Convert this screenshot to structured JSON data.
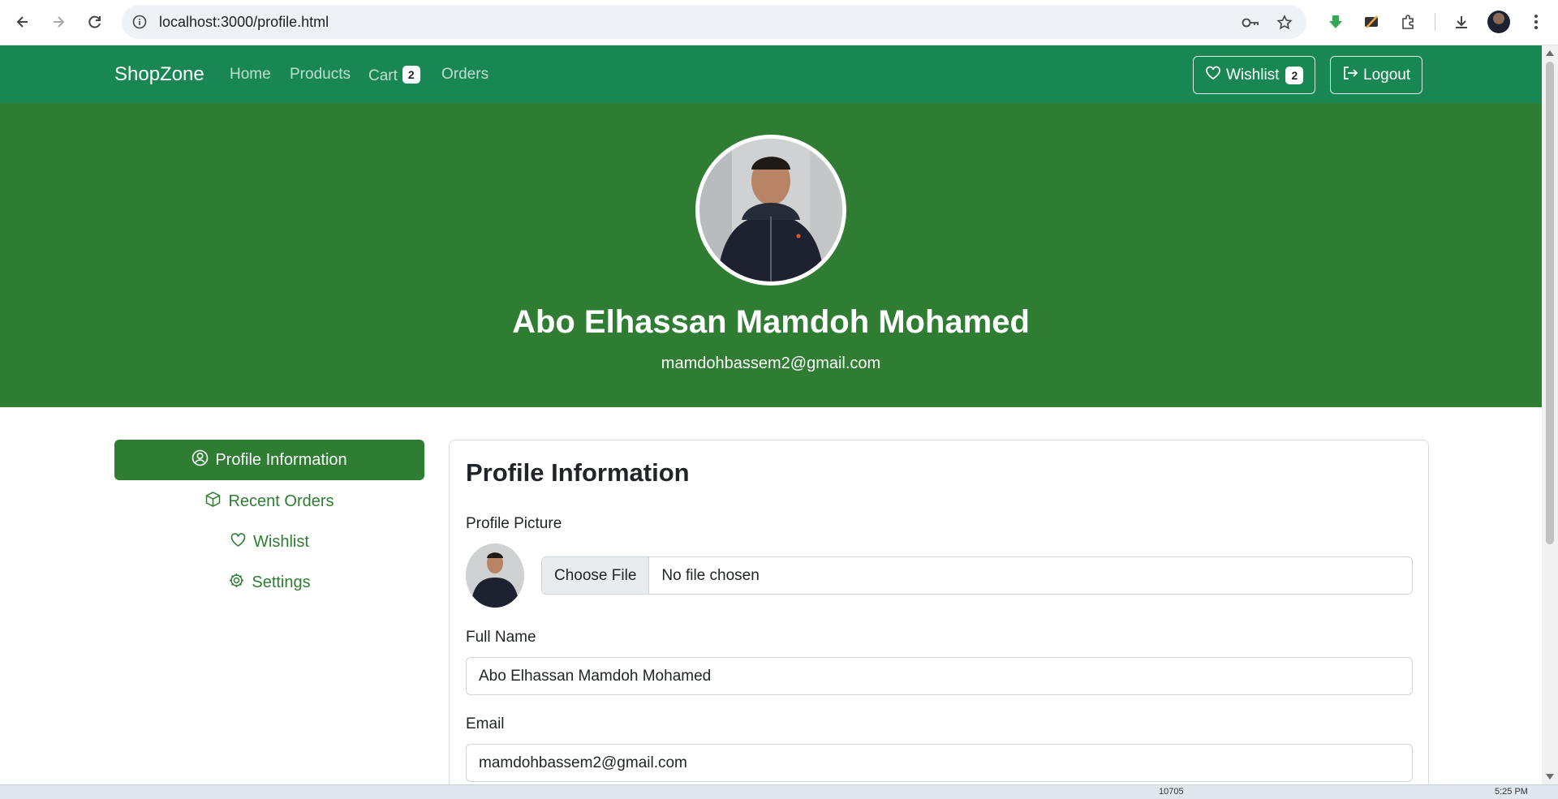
{
  "browser": {
    "url": "localhost:3000/profile.html"
  },
  "navbar": {
    "brand": "ShopZone",
    "links": [
      "Home",
      "Products",
      "Cart",
      "Orders"
    ],
    "cart_count": "2",
    "wishlist_label": "Wishlist",
    "wishlist_count": "2",
    "logout_label": "Logout",
    "color": "#198754"
  },
  "hero": {
    "name": "Abo Elhassan Mamdoh Mohamed",
    "email": "mamdohbassem2@gmail.com",
    "color": "#2e7d32"
  },
  "sidebar": {
    "items": [
      {
        "label": "Profile Information",
        "icon": "person-circle-icon",
        "active": true
      },
      {
        "label": "Recent Orders",
        "icon": "box-icon",
        "active": false
      },
      {
        "label": "Wishlist",
        "icon": "heart-icon",
        "active": false
      },
      {
        "label": "Settings",
        "icon": "gear-icon",
        "active": false
      }
    ]
  },
  "profile_form": {
    "title": "Profile Information",
    "picture_label": "Profile Picture",
    "choose_file_label": "Choose File",
    "file_status": "No file chosen",
    "full_name_label": "Full Name",
    "full_name_value": "Abo Elhassan Mamdoh Mohamed",
    "email_label": "Email",
    "email_value": "mamdohbassem2@gmail.com"
  },
  "taskbar": {
    "center_text": "10705",
    "clock": "5:25 PM"
  }
}
